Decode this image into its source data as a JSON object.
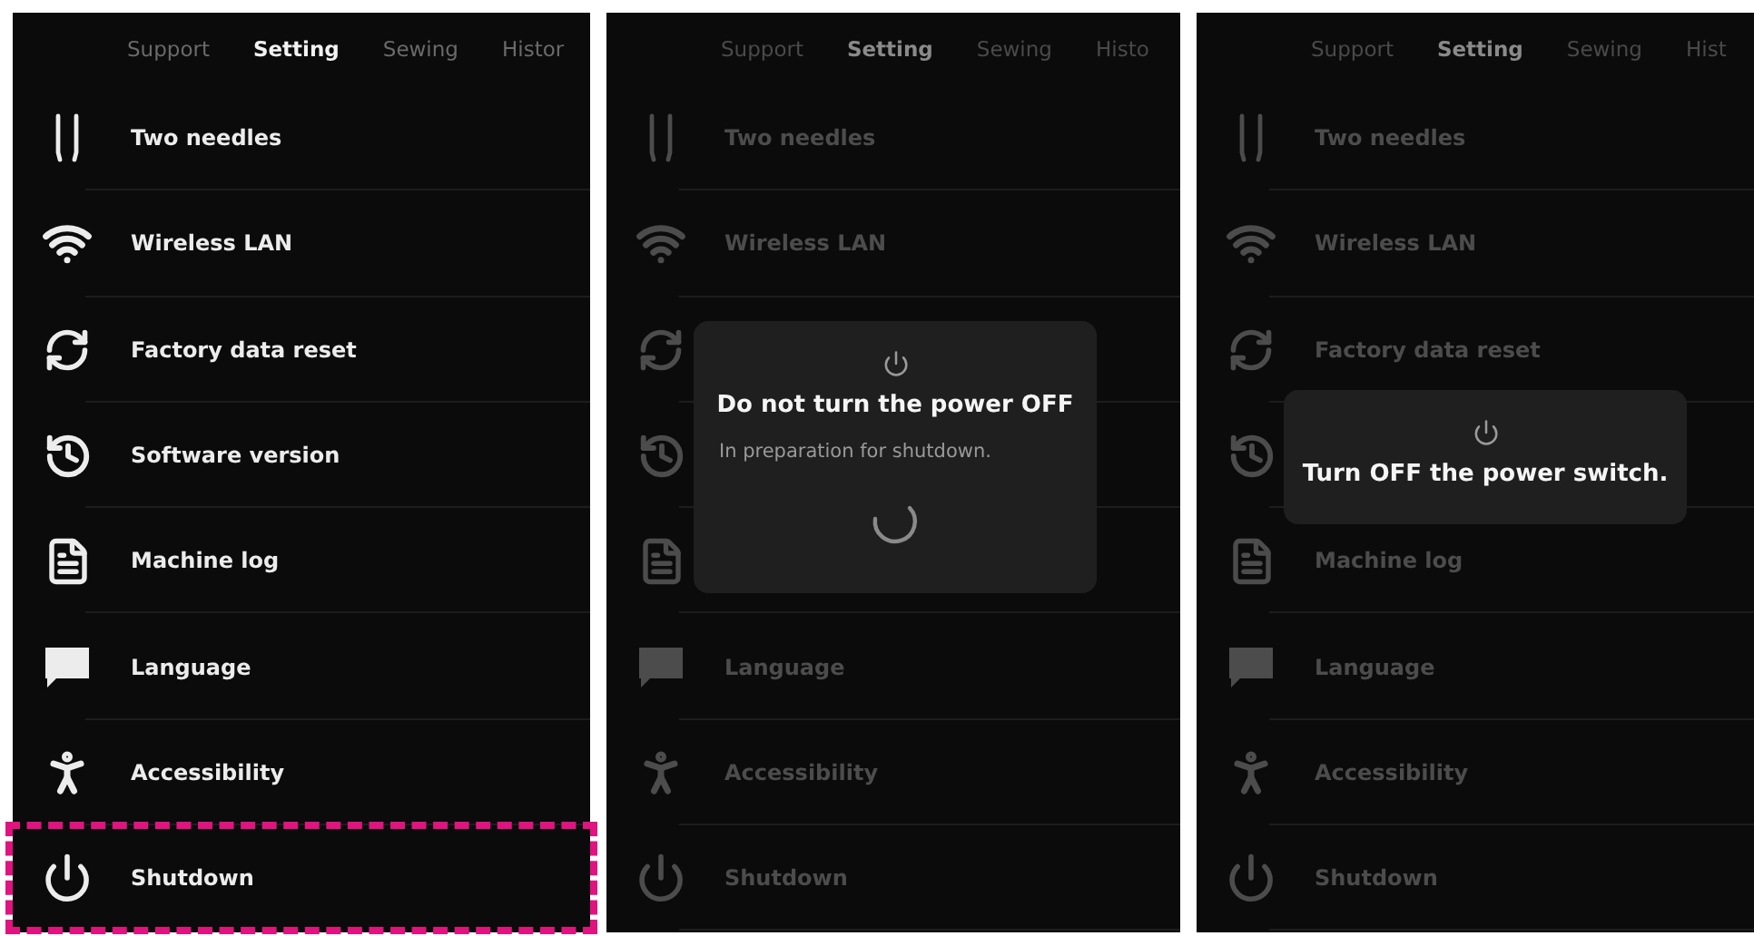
{
  "screens": [
    {
      "dimmed": false,
      "tabs": [
        {
          "label": "Support",
          "selected": false
        },
        {
          "label": "Setting",
          "selected": true
        },
        {
          "label": "Sewing",
          "selected": false
        },
        {
          "label": "Histor",
          "selected": false
        }
      ],
      "items": [
        {
          "label": "Two needles",
          "highlighted": false
        },
        {
          "label": "Wireless LAN",
          "highlighted": false
        },
        {
          "label": "Factory data reset",
          "highlighted": false
        },
        {
          "label": "Software version",
          "highlighted": false
        },
        {
          "label": "Machine log",
          "highlighted": false
        },
        {
          "label": "Language",
          "highlighted": false
        },
        {
          "label": "Accessibility",
          "highlighted": false
        },
        {
          "label": "Shutdown",
          "highlighted": true
        }
      ]
    },
    {
      "dimmed": true,
      "tabs": [
        {
          "label": "Support",
          "selected": false
        },
        {
          "label": "Setting",
          "selected": true
        },
        {
          "label": "Sewing",
          "selected": false
        },
        {
          "label": "Histo",
          "selected": false
        }
      ],
      "items": [
        {
          "label": "Two needles",
          "highlighted": false
        },
        {
          "label": "Wireless LAN",
          "highlighted": false
        },
        {
          "highlighted": false
        },
        {
          "highlighted": false
        },
        {
          "highlighted": false
        },
        {
          "label": "Language",
          "highlighted": false
        },
        {
          "label": "Accessibility",
          "highlighted": false
        },
        {
          "label": "Shutdown",
          "highlighted": false
        }
      ],
      "dialog": {
        "title": "Do not turn the power OFF",
        "message": "In preparation for shutdown.",
        "busy": true
      }
    },
    {
      "dimmed": true,
      "tabs": [
        {
          "label": "Support",
          "selected": false
        },
        {
          "label": "Setting",
          "selected": true
        },
        {
          "label": "Sewing",
          "selected": false
        },
        {
          "label": "Hist",
          "selected": false
        }
      ],
      "items": [
        {
          "label": "Two needles",
          "highlighted": false
        },
        {
          "label": "Wireless LAN",
          "highlighted": false
        },
        {
          "label": "Factory data reset",
          "highlighted": false
        },
        {
          "highlighted": false
        },
        {
          "label": "Machine log",
          "highlighted": false
        },
        {
          "label": "Language",
          "highlighted": false
        },
        {
          "label": "Accessibility",
          "highlighted": false
        },
        {
          "label": "Shutdown",
          "highlighted": false
        }
      ],
      "dialog": {
        "title": "Turn OFF the power switch.",
        "busy": false
      }
    }
  ]
}
